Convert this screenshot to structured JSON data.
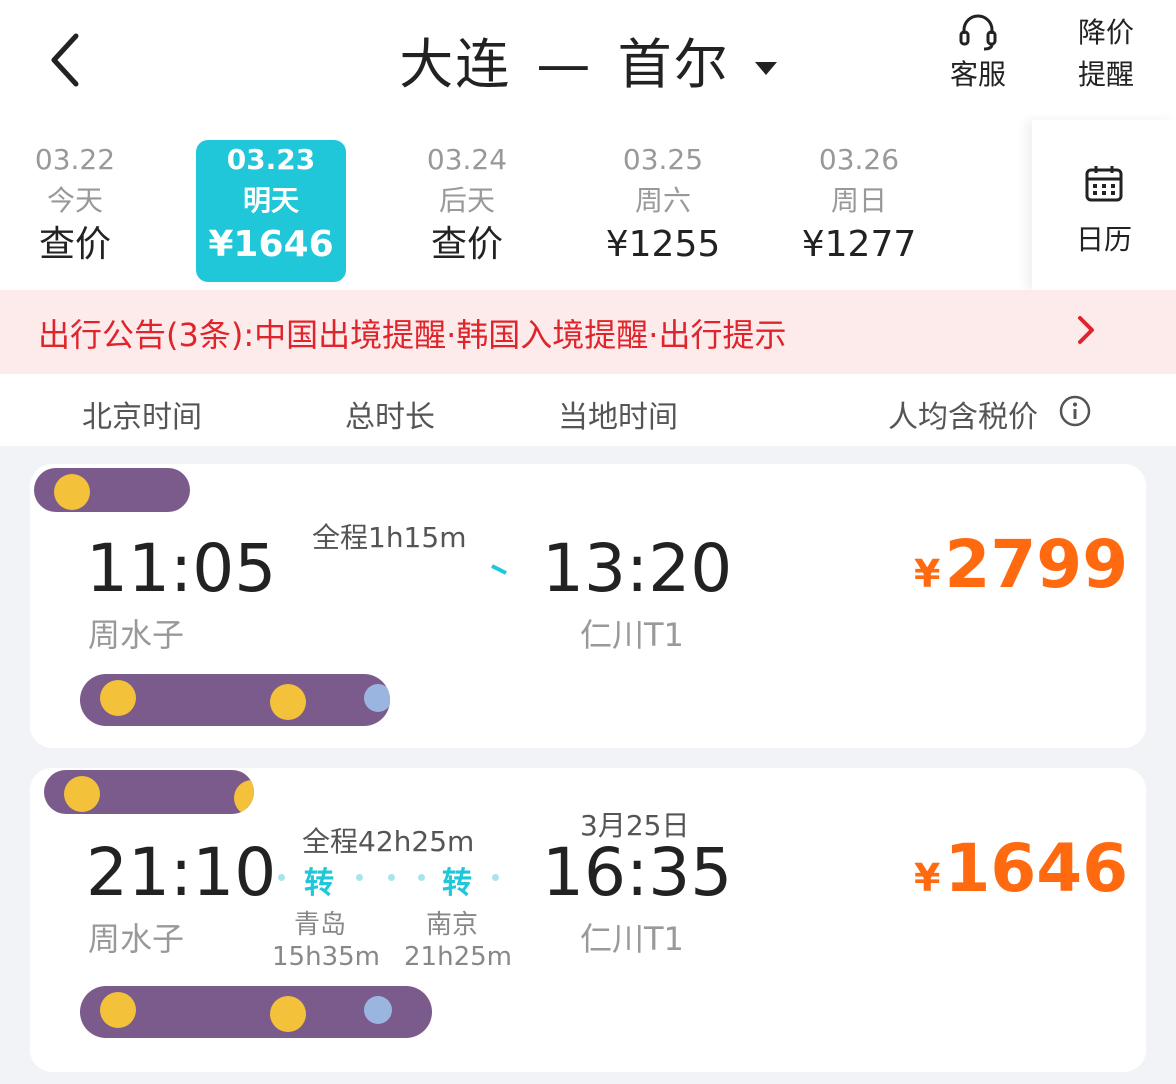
{
  "header": {
    "origin": "大连",
    "separator": "—",
    "destination": "首尔",
    "service_label": "客服",
    "price_alert_line1": "降价",
    "price_alert_line2": "提醒"
  },
  "dates": [
    {
      "date": "03.22",
      "weekday": "今天",
      "price": "查价",
      "selected": false
    },
    {
      "date": "03.23",
      "weekday": "明天",
      "price": "¥1646",
      "selected": true
    },
    {
      "date": "03.24",
      "weekday": "后天",
      "price": "查价",
      "selected": false
    },
    {
      "date": "03.25",
      "weekday": "周六",
      "price": "¥1255",
      "selected": false
    },
    {
      "date": "03.26",
      "weekday": "周日",
      "price": "¥1277",
      "selected": false
    }
  ],
  "calendar_label": "日历",
  "notice": {
    "text": "出行公告(3条):中国出境提醒·韩国入境提醒·出行提示"
  },
  "sort": {
    "col1": "北京时间",
    "col2": "总时长",
    "col3": "当地时间",
    "col4": "人均含税价"
  },
  "flights": [
    {
      "dep_time": "11:05",
      "dep_airport": "周水子",
      "duration": "全程1h15m",
      "arr_time": "13:20",
      "arr_airport": "仁川T1",
      "currency": "¥",
      "price": "2799"
    },
    {
      "dep_time": "21:10",
      "dep_airport": "周水子",
      "duration": "全程42h25m",
      "arr_date": "3月25日",
      "arr_time": "16:35",
      "arr_airport": "仁川T1",
      "currency": "¥",
      "price": "1646",
      "transfer_label": "转",
      "stops": [
        {
          "city": "青岛",
          "layover": "15h35m"
        },
        {
          "city": "南京",
          "layover": "21h25m"
        }
      ]
    }
  ],
  "colors": {
    "accent": "#1fc7d8",
    "price": "#ff6a10",
    "notice": "#e0242b"
  },
  "icons": [
    "back-arrow-icon",
    "headset-icon",
    "calendar-icon",
    "chevron-right-icon",
    "info-icon",
    "dropdown-caret-icon"
  ]
}
